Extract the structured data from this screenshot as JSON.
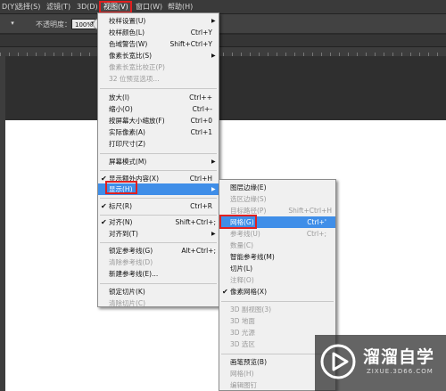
{
  "menubar": {
    "items": [
      "D(Y)",
      "选择(S)",
      "滤镜(T)",
      "3D(D)",
      "视图(V)",
      "窗口(W)",
      "帮助(H)"
    ]
  },
  "options": {
    "opacity_label": "不透明度：",
    "opacity_value": "100%"
  },
  "view_menu": {
    "items": [
      {
        "label": "校样设置(U)",
        "shortcut": "",
        "submenu": true
      },
      {
        "label": "校样颜色(L)",
        "shortcut": "Ctrl+Y"
      },
      {
        "label": "色域警告(W)",
        "shortcut": "Shift+Ctrl+Y"
      },
      {
        "label": "像素长宽比(S)",
        "shortcut": "",
        "submenu": true
      },
      {
        "label": "像素长宽比校正(P)",
        "shortcut": "",
        "disabled": true
      },
      {
        "label": "32 位预览选项...",
        "shortcut": "",
        "disabled": true
      },
      {
        "label": "放大(I)",
        "shortcut": "Ctrl++"
      },
      {
        "label": "缩小(O)",
        "shortcut": "Ctrl+-"
      },
      {
        "label": "按屏幕大小缩放(F)",
        "shortcut": "Ctrl+0"
      },
      {
        "label": "实际像素(A)",
        "shortcut": "Ctrl+1"
      },
      {
        "label": "打印尺寸(Z)",
        "shortcut": ""
      },
      {
        "label": "屏幕模式(M)",
        "shortcut": "",
        "submenu": true
      },
      {
        "label": "显示额外内容(X)",
        "shortcut": "Ctrl+H",
        "checked": true
      },
      {
        "label": "显示(H)",
        "shortcut": "",
        "submenu": true
      },
      {
        "label": "标尺(R)",
        "shortcut": "Ctrl+R",
        "checked": true
      },
      {
        "label": "对齐(N)",
        "shortcut": "Shift+Ctrl+;",
        "checked": true
      },
      {
        "label": "对齐到(T)",
        "shortcut": "",
        "submenu": true
      },
      {
        "label": "锁定参考线(G)",
        "shortcut": "Alt+Ctrl+;"
      },
      {
        "label": "清除参考线(D)",
        "shortcut": "",
        "disabled": true
      },
      {
        "label": "新建参考线(E)...",
        "shortcut": ""
      },
      {
        "label": "锁定切片(K)",
        "shortcut": ""
      },
      {
        "label": "清除切片(C)",
        "shortcut": "",
        "disabled": true
      }
    ]
  },
  "show_submenu": {
    "items": [
      {
        "label": "图层边缘(E)",
        "shortcut": ""
      },
      {
        "label": "选区边缘(S)",
        "shortcut": "",
        "disabled": true
      },
      {
        "label": "目标路径(P)",
        "shortcut": "Shift+Ctrl+H",
        "disabled": true
      },
      {
        "label": "网格(G)",
        "shortcut": "Ctrl+'"
      },
      {
        "label": "参考线(U)",
        "shortcut": "Ctrl+;",
        "disabled": true
      },
      {
        "label": "数量(C)",
        "shortcut": "",
        "disabled": true
      },
      {
        "label": "智能参考线(M)",
        "shortcut": ""
      },
      {
        "label": "切片(L)",
        "shortcut": ""
      },
      {
        "label": "注释(O)",
        "shortcut": "",
        "disabled": true
      },
      {
        "label": "像素网格(X)",
        "shortcut": "",
        "checked": true
      },
      {
        "label": "3D 副视图(3)",
        "shortcut": "",
        "disabled": true
      },
      {
        "label": "3D 地面",
        "shortcut": "",
        "disabled": true
      },
      {
        "label": "3D 光源",
        "shortcut": "",
        "disabled": true
      },
      {
        "label": "3D 选区",
        "shortcut": "",
        "disabled": true
      },
      {
        "label": "画笔预览(B)",
        "shortcut": ""
      },
      {
        "label": "网格(H)",
        "shortcut": "",
        "disabled": true
      },
      {
        "label": "编辑图钉",
        "shortcut": "",
        "disabled": true
      }
    ]
  },
  "watermark": {
    "title": "溜溜自学",
    "url": "ZIXUE.3D66.COM"
  },
  "colors": {
    "highlight": "#3f8ee8",
    "annotation": "#e02020"
  }
}
